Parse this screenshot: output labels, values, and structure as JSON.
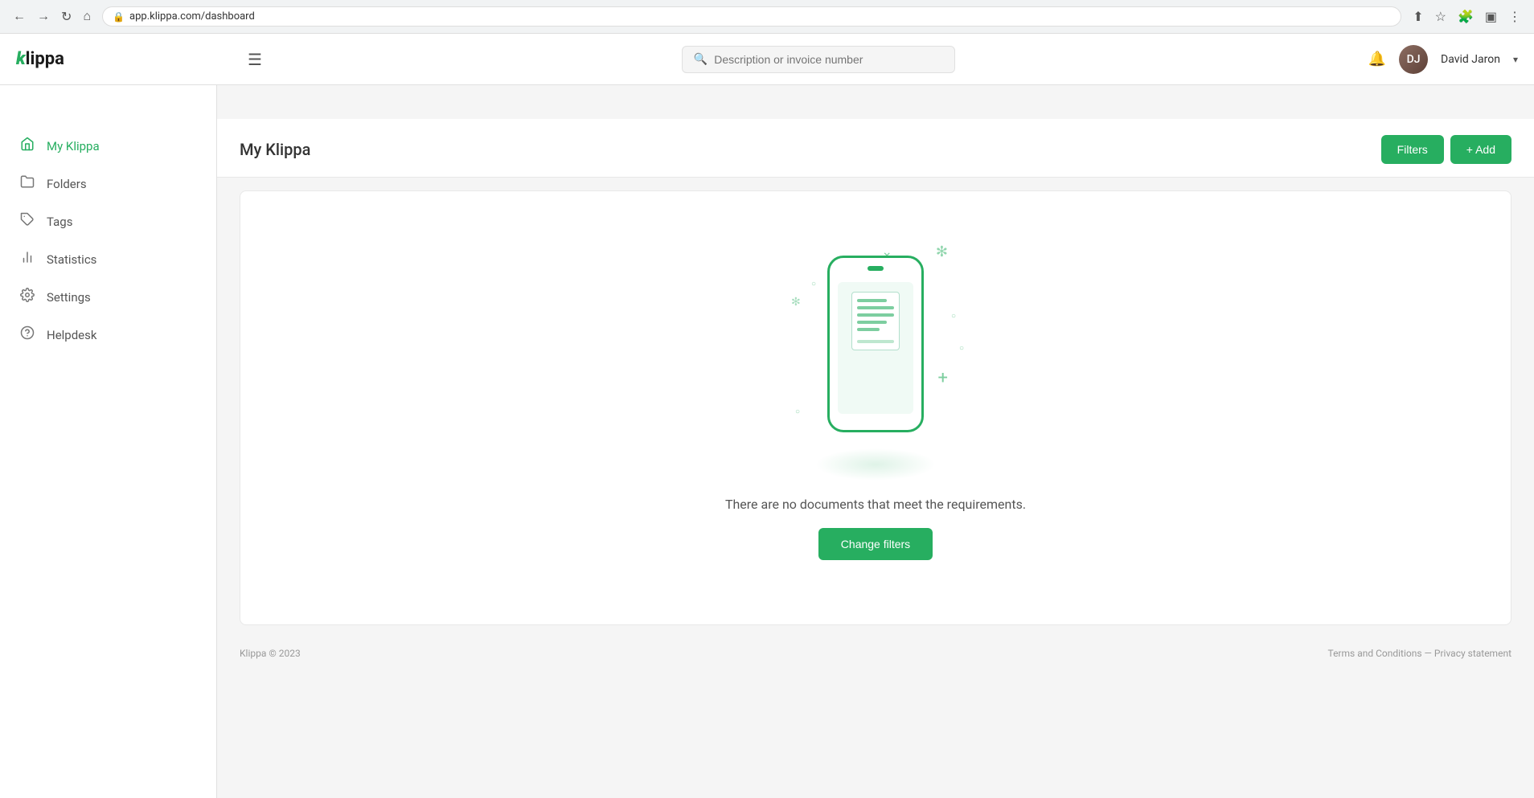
{
  "browser": {
    "url": "app.klippa.com/dashboard",
    "back_title": "back",
    "forward_title": "forward",
    "reload_title": "reload"
  },
  "topnav": {
    "logo_k": "k",
    "logo_lippa": "lippa",
    "hamburger_label": "☰",
    "search_placeholder": "Description or invoice number",
    "user_name": "David Jaron",
    "chevron": "▾"
  },
  "sidebar": {
    "items": [
      {
        "id": "my-klippa",
        "label": "My Klippa",
        "icon": "🏠",
        "active": true
      },
      {
        "id": "folders",
        "label": "Folders",
        "icon": "📁",
        "active": false
      },
      {
        "id": "tags",
        "label": "Tags",
        "icon": "🏷",
        "active": false
      },
      {
        "id": "statistics",
        "label": "Statistics",
        "icon": "📊",
        "active": false
      },
      {
        "id": "settings",
        "label": "Settings",
        "icon": "⚙",
        "active": false
      },
      {
        "id": "helpdesk",
        "label": "Helpdesk",
        "icon": "❓",
        "active": false
      }
    ]
  },
  "page": {
    "title": "My Klippa",
    "filters_btn": "Filters",
    "add_btn": "+ Add",
    "empty_message": "There are no documents that meet the requirements.",
    "change_filters_btn": "Change filters"
  },
  "footer": {
    "copyright": "Klippa © 2023",
    "links": "Terms and Conditions  —  Privacy statement"
  },
  "decorations": [
    {
      "symbol": "×",
      "class": "d1"
    },
    {
      "symbol": "✻",
      "class": "d2"
    },
    {
      "symbol": "○",
      "class": "d3"
    },
    {
      "symbol": "✻",
      "class": "d4"
    },
    {
      "symbol": "○",
      "class": "d5"
    },
    {
      "symbol": "○",
      "class": "d6"
    },
    {
      "symbol": "○",
      "class": "d7"
    },
    {
      "symbol": "+",
      "class": "d8"
    }
  ]
}
